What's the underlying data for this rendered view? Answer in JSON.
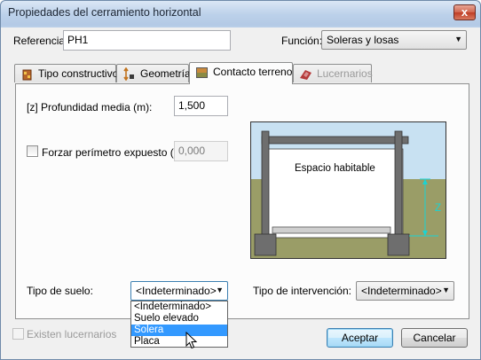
{
  "window": {
    "title": "Propiedades del cerramiento horizontal",
    "close_glyph": "x"
  },
  "referencia": {
    "label": "Referencia:",
    "value": "PH1"
  },
  "funcion": {
    "label": "Función:",
    "value": "Soleras y losas"
  },
  "tabs": [
    {
      "label": "Tipo constructivo",
      "icon": "wall-layers-icon",
      "state": "normal"
    },
    {
      "label": "Geometría",
      "icon": "dimensions-icon",
      "state": "normal"
    },
    {
      "label": "Contacto terreno",
      "icon": "ground-contact-icon",
      "state": "active"
    },
    {
      "label": "Lucernarios",
      "icon": "skylight-icon",
      "state": "disabled"
    }
  ],
  "profundidad": {
    "label": "[z] Profundidad media (m):",
    "value": "1,500"
  },
  "perimetro": {
    "label": "Forzar perímetro expuesto (m):",
    "value": "0,000",
    "checked": false,
    "enabled": true
  },
  "diagram": {
    "space_label": "Espacio habitable",
    "dimension_label": "Z"
  },
  "tipo_suelo": {
    "label": "Tipo de suelo:",
    "value": "<Indeterminado>",
    "options": [
      "<Indeterminado>",
      "Suelo elevado",
      "Solera",
      "Placa"
    ],
    "highlighted": "Solera"
  },
  "tipo_intervencion": {
    "label": "Tipo de intervención:",
    "value": "<Indeterminado>"
  },
  "lucernarios_check": {
    "label": "Existen lucernarios",
    "checked": false,
    "enabled": false
  },
  "buttons": {
    "accept": "Aceptar",
    "cancel": "Cancelar"
  },
  "colors": {
    "sky": "#c8e1f2",
    "ground": "#9a9d67",
    "structure": "#6e6e6e",
    "dimension": "#19d4d4"
  }
}
